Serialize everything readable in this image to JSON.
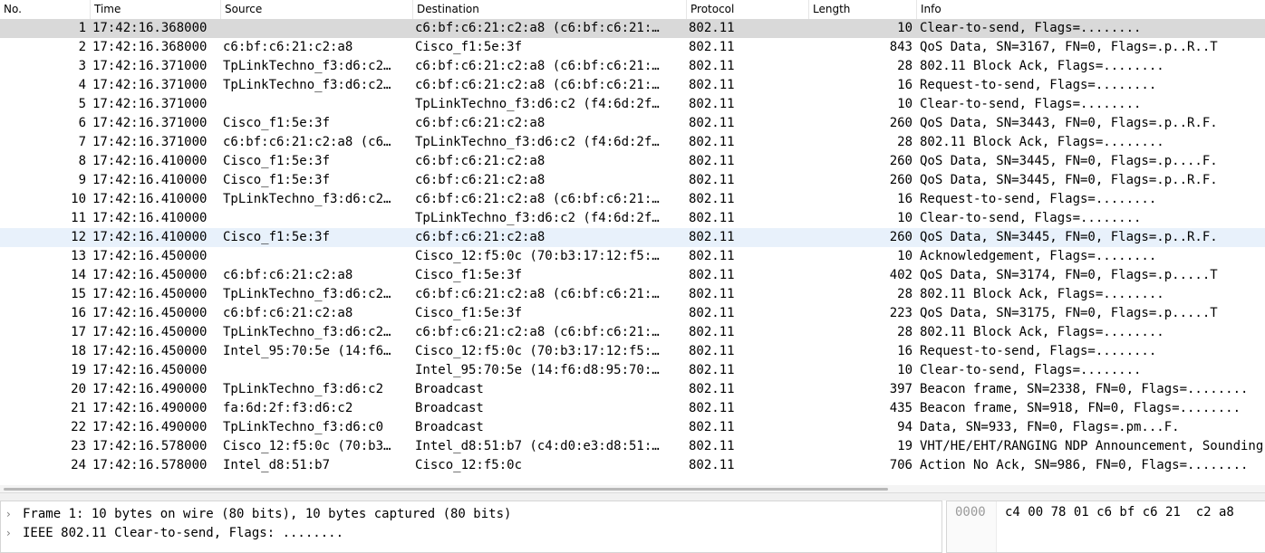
{
  "columns": {
    "no": "No.",
    "time": "Time",
    "source": "Source",
    "destination": "Destination",
    "protocol": "Protocol",
    "length": "Length",
    "info": "Info"
  },
  "packets": [
    {
      "no": "1",
      "time": "17:42:16.368000",
      "src": "",
      "dst": "c6:bf:c6:21:c2:a8 (c6:bf:c6:21:…",
      "proto": "802.11",
      "len": "10",
      "info": "Clear-to-send, Flags=........"
    },
    {
      "no": "2",
      "time": "17:42:16.368000",
      "src": "c6:bf:c6:21:c2:a8",
      "dst": "Cisco_f1:5e:3f",
      "proto": "802.11",
      "len": "843",
      "info": "QoS Data, SN=3167, FN=0, Flags=.p..R..T"
    },
    {
      "no": "3",
      "time": "17:42:16.371000",
      "src": "TpLinkTechno_f3:d6:c2…",
      "dst": "c6:bf:c6:21:c2:a8 (c6:bf:c6:21:…",
      "proto": "802.11",
      "len": "28",
      "info": "802.11 Block Ack, Flags=........"
    },
    {
      "no": "4",
      "time": "17:42:16.371000",
      "src": "TpLinkTechno_f3:d6:c2…",
      "dst": "c6:bf:c6:21:c2:a8 (c6:bf:c6:21:…",
      "proto": "802.11",
      "len": "16",
      "info": "Request-to-send, Flags=........"
    },
    {
      "no": "5",
      "time": "17:42:16.371000",
      "src": "",
      "dst": "TpLinkTechno_f3:d6:c2 (f4:6d:2f…",
      "proto": "802.11",
      "len": "10",
      "info": "Clear-to-send, Flags=........"
    },
    {
      "no": "6",
      "time": "17:42:16.371000",
      "src": "Cisco_f1:5e:3f",
      "dst": "c6:bf:c6:21:c2:a8",
      "proto": "802.11",
      "len": "260",
      "info": "QoS Data, SN=3443, FN=0, Flags=.p..R.F."
    },
    {
      "no": "7",
      "time": "17:42:16.371000",
      "src": "c6:bf:c6:21:c2:a8 (c6…",
      "dst": "TpLinkTechno_f3:d6:c2 (f4:6d:2f…",
      "proto": "802.11",
      "len": "28",
      "info": "802.11 Block Ack, Flags=........"
    },
    {
      "no": "8",
      "time": "17:42:16.410000",
      "src": "Cisco_f1:5e:3f",
      "dst": "c6:bf:c6:21:c2:a8",
      "proto": "802.11",
      "len": "260",
      "info": "QoS Data, SN=3445, FN=0, Flags=.p....F."
    },
    {
      "no": "9",
      "time": "17:42:16.410000",
      "src": "Cisco_f1:5e:3f",
      "dst": "c6:bf:c6:21:c2:a8",
      "proto": "802.11",
      "len": "260",
      "info": "QoS Data, SN=3445, FN=0, Flags=.p..R.F."
    },
    {
      "no": "10",
      "time": "17:42:16.410000",
      "src": "TpLinkTechno_f3:d6:c2…",
      "dst": "c6:bf:c6:21:c2:a8 (c6:bf:c6:21:…",
      "proto": "802.11",
      "len": "16",
      "info": "Request-to-send, Flags=........"
    },
    {
      "no": "11",
      "time": "17:42:16.410000",
      "src": "",
      "dst": "TpLinkTechno_f3:d6:c2 (f4:6d:2f…",
      "proto": "802.11",
      "len": "10",
      "info": "Clear-to-send, Flags=........"
    },
    {
      "no": "12",
      "time": "17:42:16.410000",
      "src": "Cisco_f1:5e:3f",
      "dst": "c6:bf:c6:21:c2:a8",
      "proto": "802.11",
      "len": "260",
      "info": "QoS Data, SN=3445, FN=0, Flags=.p..R.F."
    },
    {
      "no": "13",
      "time": "17:42:16.450000",
      "src": "",
      "dst": "Cisco_12:f5:0c (70:b3:17:12:f5:…",
      "proto": "802.11",
      "len": "10",
      "info": "Acknowledgement, Flags=........"
    },
    {
      "no": "14",
      "time": "17:42:16.450000",
      "src": "c6:bf:c6:21:c2:a8",
      "dst": "Cisco_f1:5e:3f",
      "proto": "802.11",
      "len": "402",
      "info": "QoS Data, SN=3174, FN=0, Flags=.p.....T"
    },
    {
      "no": "15",
      "time": "17:42:16.450000",
      "src": "TpLinkTechno_f3:d6:c2…",
      "dst": "c6:bf:c6:21:c2:a8 (c6:bf:c6:21:…",
      "proto": "802.11",
      "len": "28",
      "info": "802.11 Block Ack, Flags=........"
    },
    {
      "no": "16",
      "time": "17:42:16.450000",
      "src": "c6:bf:c6:21:c2:a8",
      "dst": "Cisco_f1:5e:3f",
      "proto": "802.11",
      "len": "223",
      "info": "QoS Data, SN=3175, FN=0, Flags=.p.....T"
    },
    {
      "no": "17",
      "time": "17:42:16.450000",
      "src": "TpLinkTechno_f3:d6:c2…",
      "dst": "c6:bf:c6:21:c2:a8 (c6:bf:c6:21:…",
      "proto": "802.11",
      "len": "28",
      "info": "802.11 Block Ack, Flags=........"
    },
    {
      "no": "18",
      "time": "17:42:16.450000",
      "src": "Intel_95:70:5e (14:f6…",
      "dst": "Cisco_12:f5:0c (70:b3:17:12:f5:…",
      "proto": "802.11",
      "len": "16",
      "info": "Request-to-send, Flags=........"
    },
    {
      "no": "19",
      "time": "17:42:16.450000",
      "src": "",
      "dst": "Intel_95:70:5e (14:f6:d8:95:70:…",
      "proto": "802.11",
      "len": "10",
      "info": "Clear-to-send, Flags=........"
    },
    {
      "no": "20",
      "time": "17:42:16.490000",
      "src": "TpLinkTechno_f3:d6:c2",
      "dst": "Broadcast",
      "proto": "802.11",
      "len": "397",
      "info": "Beacon frame, SN=2338, FN=0, Flags=........"
    },
    {
      "no": "21",
      "time": "17:42:16.490000",
      "src": "fa:6d:2f:f3:d6:c2",
      "dst": "Broadcast",
      "proto": "802.11",
      "len": "435",
      "info": "Beacon frame, SN=918, FN=0, Flags=........"
    },
    {
      "no": "22",
      "time": "17:42:16.490000",
      "src": "TpLinkTechno_f3:d6:c0",
      "dst": "Broadcast",
      "proto": "802.11",
      "len": "94",
      "info": "Data, SN=933, FN=0, Flags=.pm...F."
    },
    {
      "no": "23",
      "time": "17:42:16.578000",
      "src": "Cisco_12:f5:0c (70:b3…",
      "dst": "Intel_d8:51:b7 (c4:d0:e3:d8:51:…",
      "proto": "802.11",
      "len": "19",
      "info": "VHT/HE/EHT/RANGING NDP Announcement, Sounding"
    },
    {
      "no": "24",
      "time": "17:42:16.578000",
      "src": "Intel_d8:51:b7",
      "dst": "Cisco_12:f5:0c",
      "proto": "802.11",
      "len": "706",
      "info": "Action No Ack, SN=986, FN=0, Flags=........"
    }
  ],
  "selected_row": "1",
  "details": [
    {
      "text": "Frame 1: 10 bytes on wire (80 bits), 10 bytes captured (80 bits)",
      "icon": "chevron-right-icon"
    },
    {
      "text": "IEEE 802.11 Clear-to-send, Flags: ........",
      "icon": "chevron-right-icon"
    }
  ],
  "bytes": {
    "offset": "0000",
    "hex": "c4 00 78 01 c6 bf c6 21  c2 a8"
  },
  "colors": {
    "selected_row": "#d9d9d9",
    "hover_row": "#e8f1fb",
    "offset_text": "#9a9a9a"
  }
}
